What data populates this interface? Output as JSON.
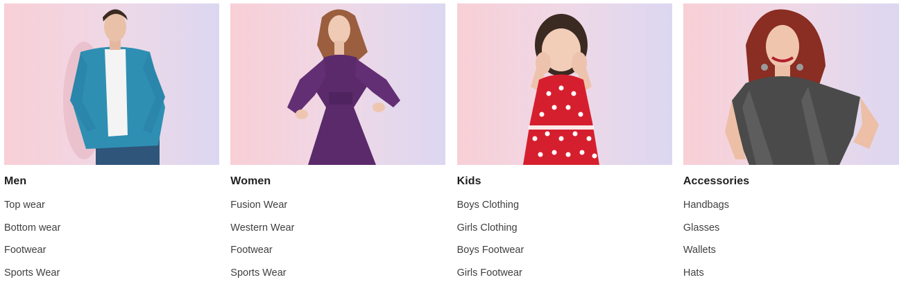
{
  "categories": [
    {
      "title": "Men",
      "items": [
        "Top wear",
        "Bottom wear",
        "Footwear",
        "Sports Wear"
      ]
    },
    {
      "title": "Women",
      "items": [
        "Fusion Wear",
        "Western Wear",
        "Footwear",
        "Sports Wear"
      ]
    },
    {
      "title": "Kids",
      "items": [
        "Boys Clothing",
        "Girls Clothing",
        "Boys Footwear",
        "Girls Footwear"
      ]
    },
    {
      "title": "Accessories",
      "items": [
        "Handbags",
        "Glasses",
        "Wallets",
        "Hats"
      ]
    }
  ],
  "colors": {
    "bg_pink": "#f8cfd6",
    "bg_lavender": "#dcd7f1",
    "title_text": "#1f1f1f",
    "link_text": "#3f3f3f"
  }
}
